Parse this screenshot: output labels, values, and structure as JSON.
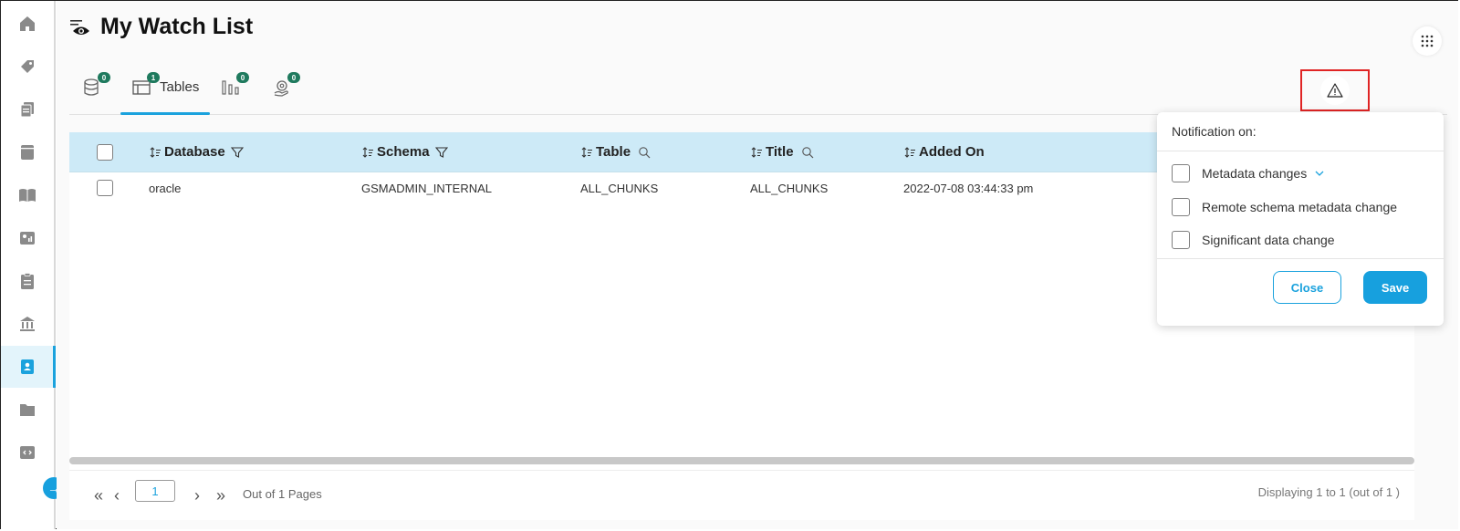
{
  "page": {
    "title": "My Watch List"
  },
  "sidebar": {
    "items": [
      {
        "name": "home-icon"
      },
      {
        "name": "tag-icon"
      },
      {
        "name": "documents-icon"
      },
      {
        "name": "book-icon"
      },
      {
        "name": "open-book-icon"
      },
      {
        "name": "dashboard-icon"
      },
      {
        "name": "clipboard-icon"
      },
      {
        "name": "bank-icon"
      },
      {
        "name": "contacts-icon",
        "active": true
      },
      {
        "name": "folder-icon"
      },
      {
        "name": "code-icon"
      }
    ]
  },
  "tabs": [
    {
      "name": "tab-databases",
      "icon": "database-icon",
      "badge": "0",
      "label": ""
    },
    {
      "name": "tab-tables",
      "icon": "table-icon",
      "badge": "1",
      "label": "Tables",
      "active": true
    },
    {
      "name": "tab-reports",
      "icon": "bar-chart-icon",
      "badge": "0",
      "label": ""
    },
    {
      "name": "tab-settings",
      "icon": "gear-hand-icon",
      "badge": "0",
      "label": ""
    }
  ],
  "table": {
    "columns": [
      "Database",
      "Schema",
      "Table",
      "Title",
      "Added On"
    ],
    "rows": [
      {
        "database": "oracle",
        "schema": "GSMADMIN_INTERNAL",
        "table": "ALL_CHUNKS",
        "title": "ALL_CHUNKS",
        "added_on": "2022-07-08 03:44:33 pm"
      }
    ]
  },
  "pager": {
    "page": "1",
    "out_of": "Out of 1 Pages",
    "display": "Displaying 1 to 1 (out of 1 )"
  },
  "notification": {
    "heading": "Notification on:",
    "options": [
      "Metadata changes",
      "Remote schema metadata change",
      "Significant data change"
    ],
    "close_label": "Close",
    "save_label": "Save"
  },
  "colors": {
    "accent": "#1ba2dd",
    "header_bg": "#cdeaf7",
    "badge": "#1f7a5e",
    "alert_border": "#e02424"
  }
}
